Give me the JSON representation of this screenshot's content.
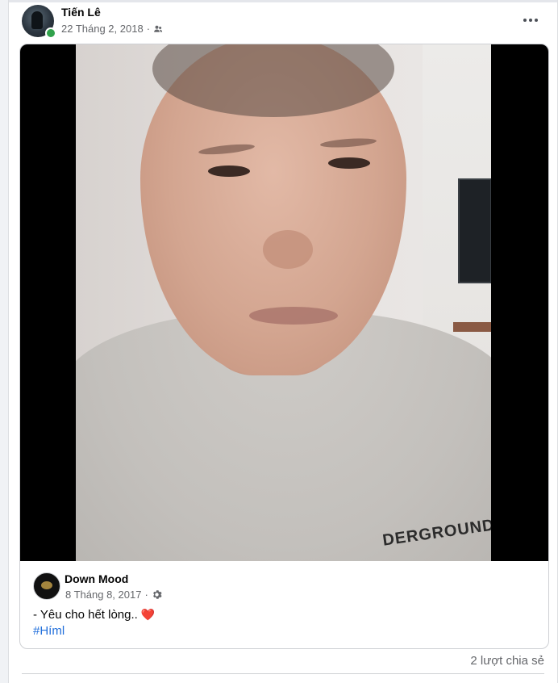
{
  "post": {
    "author": "Tiến Lê",
    "date": "22 Tháng 2, 2018",
    "separator": "·",
    "audience_icon": "friends-icon",
    "more_icon": "more-options-icon"
  },
  "shared_post": {
    "page_name": "Down Mood",
    "date": "8 Tháng 8, 2017",
    "separator": "·",
    "audience_icon": "settings-gear-icon",
    "text": "- Yêu cho hết lòng..",
    "emoji": "❤️",
    "hashtag": "#Híml",
    "video_shirt_text": "DERGROUND"
  },
  "footer": {
    "share_count": "2 lượt chia sẻ"
  },
  "colors": {
    "link": "#216fdb",
    "online": "#31a24c",
    "secondary_text": "#65676b"
  }
}
